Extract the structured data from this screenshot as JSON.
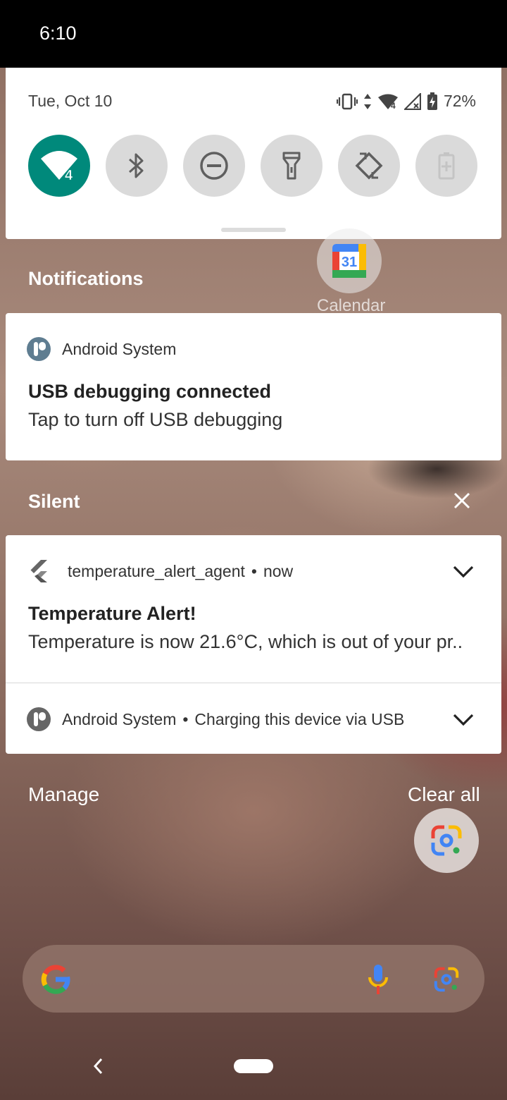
{
  "status_bar": {
    "time": "6:10"
  },
  "quick_settings": {
    "date": "Tue, Oct 10",
    "battery_percent": "72%",
    "wifi_badge": "4",
    "tiles": [
      {
        "name": "wifi",
        "active": true
      },
      {
        "name": "bluetooth",
        "active": false
      },
      {
        "name": "do-not-disturb",
        "active": false
      },
      {
        "name": "flashlight",
        "active": false
      },
      {
        "name": "auto-rotate",
        "active": false
      },
      {
        "name": "battery-saver",
        "active": false,
        "disabled": true
      }
    ]
  },
  "home_app": {
    "label": "Calendar",
    "icon_number": "31"
  },
  "notifications_header": "Notifications",
  "usb_notification": {
    "app": "Android System",
    "title": "USB debugging connected",
    "text": "Tap to turn off USB debugging"
  },
  "silent_header": "Silent",
  "temperature_notification": {
    "app": "temperature_alert_agent",
    "separator": "•",
    "time": "now",
    "title": "Temperature Alert!",
    "text": "Temperature is now 21.6°C, which is out of your pr.."
  },
  "charging_notification": {
    "app": "Android System",
    "separator": "•",
    "text": "Charging this device via USB"
  },
  "footer": {
    "manage": "Manage",
    "clear_all": "Clear all"
  },
  "colors": {
    "accent": "#00897b",
    "tile_off": "#dadada",
    "system_icon": "#5f7d91"
  }
}
